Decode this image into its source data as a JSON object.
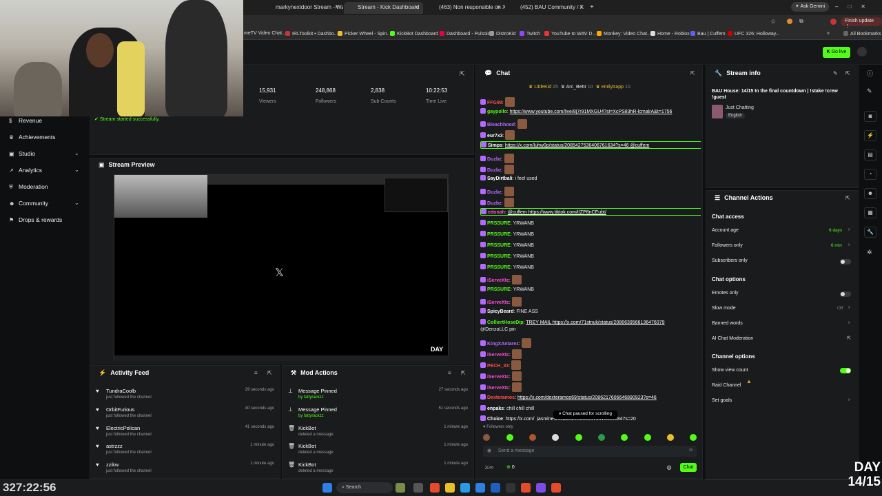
{
  "browser": {
    "tabs": [
      {
        "label": "markynextdoor Stream - Watc",
        "active": false
      },
      {
        "label": "Stream - Kick Dashboard",
        "active": true
      },
      {
        "label": "(463) Non responsible on X: \"I\"",
        "active": false
      },
      {
        "label": "(452) BAU Community / X",
        "active": false
      }
    ],
    "ask_gemini": "Ask Gemini",
    "finish_update": "Finish update",
    "bookmarks": [
      "meTV Video Chat...",
      "IRLToolkit • Dashbo...",
      "Picker Wheel - Spin...",
      "KickBot Dashboard",
      "Dashboard - Pulsoid",
      "DistroKid",
      "Twitch",
      "YouTube to WAV D...",
      "Monkey: Video Chat...",
      "Home - Roblox",
      "Bau | Cuffem",
      "UFC 326: Holloway..."
    ],
    "all_bookmarks": "All Bookmarks"
  },
  "go_live": "Go live",
  "sidebar": {
    "items": [
      {
        "label": "Revenue",
        "icon": "dollar-icon"
      },
      {
        "label": "Achievements",
        "icon": "trophy-icon"
      },
      {
        "label": "Studio",
        "icon": "studio-icon",
        "chevron": true
      },
      {
        "label": "Analytics",
        "icon": "analytics-icon",
        "chevron": true
      },
      {
        "label": "Moderation",
        "icon": "shield-icon"
      },
      {
        "label": "Community",
        "icon": "people-icon",
        "chevron": true
      },
      {
        "label": "Drops & rewards",
        "icon": "gift-icon"
      }
    ]
  },
  "stats": [
    {
      "value": "15,931",
      "label": "Viewers"
    },
    {
      "value": "248,868",
      "label": "Followers"
    },
    {
      "value": "2,838",
      "label": "Sub Counts"
    },
    {
      "value": "10:22:53",
      "label": "Time Live"
    }
  ],
  "toast": "Stream started successfully.",
  "preview": {
    "title": "Stream Preview",
    "day_text": "DAY"
  },
  "activity": {
    "title": "Activity Feed",
    "rows": [
      {
        "name": "TundraCoolb",
        "sub": "just followed the channel",
        "time": "29 seconds ago"
      },
      {
        "name": "OrbitFurious",
        "sub": "just followed the channel",
        "time": "40 seconds ago"
      },
      {
        "name": "ElectricPelican",
        "sub": "just followed the channel",
        "time": "41 seconds ago"
      },
      {
        "name": "astrzzz",
        "sub": "just followed the channel",
        "time": "1 minute ago"
      },
      {
        "name": "zzikw",
        "sub": "just followed the channel",
        "time": "1 minute ago"
      }
    ]
  },
  "mod_actions": {
    "title": "Mod Actions",
    "rows": [
      {
        "name": "Message Pinned",
        "sub": "by fattyrackzz",
        "time": "27 seconds ago",
        "icon": "pin-icon"
      },
      {
        "name": "Message Pinned",
        "sub": "by fattyrackzz",
        "time": "51 seconds ago",
        "icon": "pin-icon"
      },
      {
        "name": "KickBot",
        "sub": "deleted a message",
        "time": "1 minute ago",
        "icon": "trash-icon"
      },
      {
        "name": "KickBot",
        "sub": "deleted a message",
        "time": "1 minute ago",
        "icon": "trash-icon"
      },
      {
        "name": "KickBot",
        "sub": "deleted a message",
        "time": "1 minute ago",
        "icon": "trash-icon"
      }
    ]
  },
  "chat": {
    "title": "Chat",
    "top_gifters": [
      {
        "name": "LittleKid",
        "count": "25"
      },
      {
        "name": "Arc_Bettr",
        "count": "10"
      },
      {
        "name": "emilytrapp",
        "count": "10"
      }
    ],
    "messages": [
      {
        "user": "FFG99",
        "color": "#ff4d4d",
        "text": "",
        "emote": true
      },
      {
        "user": "gaypollo",
        "color": "#53fc18",
        "text": "https://www.youtube.com/live/8j7r91MXGU4?si=XcPS83hR-lcmalrA&t=1756",
        "link": true
      },
      {
        "user": "Bleachhood",
        "color": "#b36bff",
        "text": "",
        "emote": true
      },
      {
        "user": "eur7x3",
        "color": "#ffffff",
        "text": "",
        "emote": true
      },
      {
        "user": "Simps",
        "color": "#ffffff",
        "text": "https://x.com/luhw0p/status/2085427536406761634?s=46 @cuffem",
        "link": true,
        "highlight": true
      },
      {
        "user": "Duzbz",
        "color": "#b36bff",
        "text": "",
        "emote": true
      },
      {
        "user": "Duzbz",
        "color": "#b36bff",
        "text": "",
        "emote": true
      },
      {
        "user": "SayDirtbali",
        "color": "#ffffff",
        "text": "i feel used"
      },
      {
        "user": "Duzbz",
        "color": "#b36bff",
        "text": "",
        "emote": true
      },
      {
        "user": "Duzbz",
        "color": "#b36bff",
        "text": "",
        "emote": true
      },
      {
        "user": "edonah",
        "color": "#ff4dd2",
        "text": "@cuffem https://www.tiktok.com/t/ZP8nCEubt/",
        "link": true,
        "highlight": true
      },
      {
        "user": "PRSSURE",
        "color": "#53fc18",
        "text": "YRWANB"
      },
      {
        "user": "PRSSURE",
        "color": "#53fc18",
        "text": "YRWANB"
      },
      {
        "user": "PRSSURE",
        "color": "#53fc18",
        "text": "YRWANB"
      },
      {
        "user": "PRSSURE",
        "color": "#53fc18",
        "text": "YRWANB"
      },
      {
        "user": "PRSSURE",
        "color": "#53fc18",
        "text": "YRWANB"
      },
      {
        "user": "iServeXtc",
        "color": "#ff4dd2",
        "text": "",
        "emote": true
      },
      {
        "user": "PRSSURE",
        "color": "#53fc18",
        "text": "YRWANB"
      },
      {
        "user": "iServeXtc",
        "color": "#ff4dd2",
        "text": "",
        "emote": true
      },
      {
        "user": "SpicyBeard",
        "color": "#ffffff",
        "text": "FINE ASS"
      },
      {
        "user": "ColliertHoseDip",
        "color": "#53fc18",
        "text": "TREY MAIL https://x.com/71stnuk/status/2086639566136476079",
        "link": true
      },
      {
        "user": "",
        "color": "#ffffff",
        "text": "@DenzoLLC pin"
      },
      {
        "user": "KingXAntarez",
        "color": "#b36bff",
        "text": "",
        "emote": true
      },
      {
        "user": "iServeXtc",
        "color": "#ff4dd2",
        "text": "",
        "emote": true
      },
      {
        "user": "PECH_33",
        "color": "#ff4d4d",
        "text": "",
        "emote": true
      },
      {
        "user": "iServeXtc",
        "color": "#ff4dd2",
        "text": "",
        "emote": true
      },
      {
        "user": "iServeXtc",
        "color": "#ff4dd2",
        "text": "",
        "emote": true
      },
      {
        "user": "Dexteramos",
        "color": "#ff4d4d",
        "text": "https://x.com/dexteramos69/status/2086217606646890923?s=46",
        "link": true
      },
      {
        "user": "enpaks",
        "color": "#ffffff",
        "text": "chill chill chill"
      },
      {
        "user": "Chxice",
        "color": "#ffffff",
        "text": "https://x.com/_jasminesn/status/2086339154104091847s=20",
        "link": true
      }
    ],
    "paused": "Chat paused for scrolling",
    "followers_only": "Followers only",
    "input_placeholder": "Send a message",
    "viewer_count": "0",
    "chat_button": "Chat"
  },
  "stream_info": {
    "title": "Stream info",
    "stream_title": "BAU House: 14/15 In the final countdown | !stake !crew !guest",
    "category": "Just Chatting",
    "language": "English"
  },
  "channel_actions": {
    "title": "Channel Actions",
    "chat_access": "Chat access",
    "account_age": {
      "label": "Account age",
      "value": "6 days"
    },
    "followers_only": {
      "label": "Followers only",
      "value": "6 min"
    },
    "subscribers_only": {
      "label": "Subscribers only",
      "on": false
    },
    "chat_options": "Chat options",
    "emotes_only": {
      "label": "Emotes only",
      "on": false
    },
    "slow_mode": {
      "label": "Slow mode",
      "value": "Off"
    },
    "banned_words": "Banned words",
    "ai_moderation": "AI Chat Moderation",
    "channel_options": "Channel options",
    "show_view_count": {
      "label": "Show view count",
      "on": true
    },
    "raid_channel": "Raid Channel",
    "set_goals": "Set goals"
  },
  "overlay": {
    "timer": "327:22:56",
    "day_label": "DAY",
    "day_count": "14/15"
  },
  "taskbar": {
    "search": "Search"
  },
  "colors": {
    "accent": "#53fc18",
    "panel": "#191b1d",
    "bg": "#0d0f10"
  }
}
